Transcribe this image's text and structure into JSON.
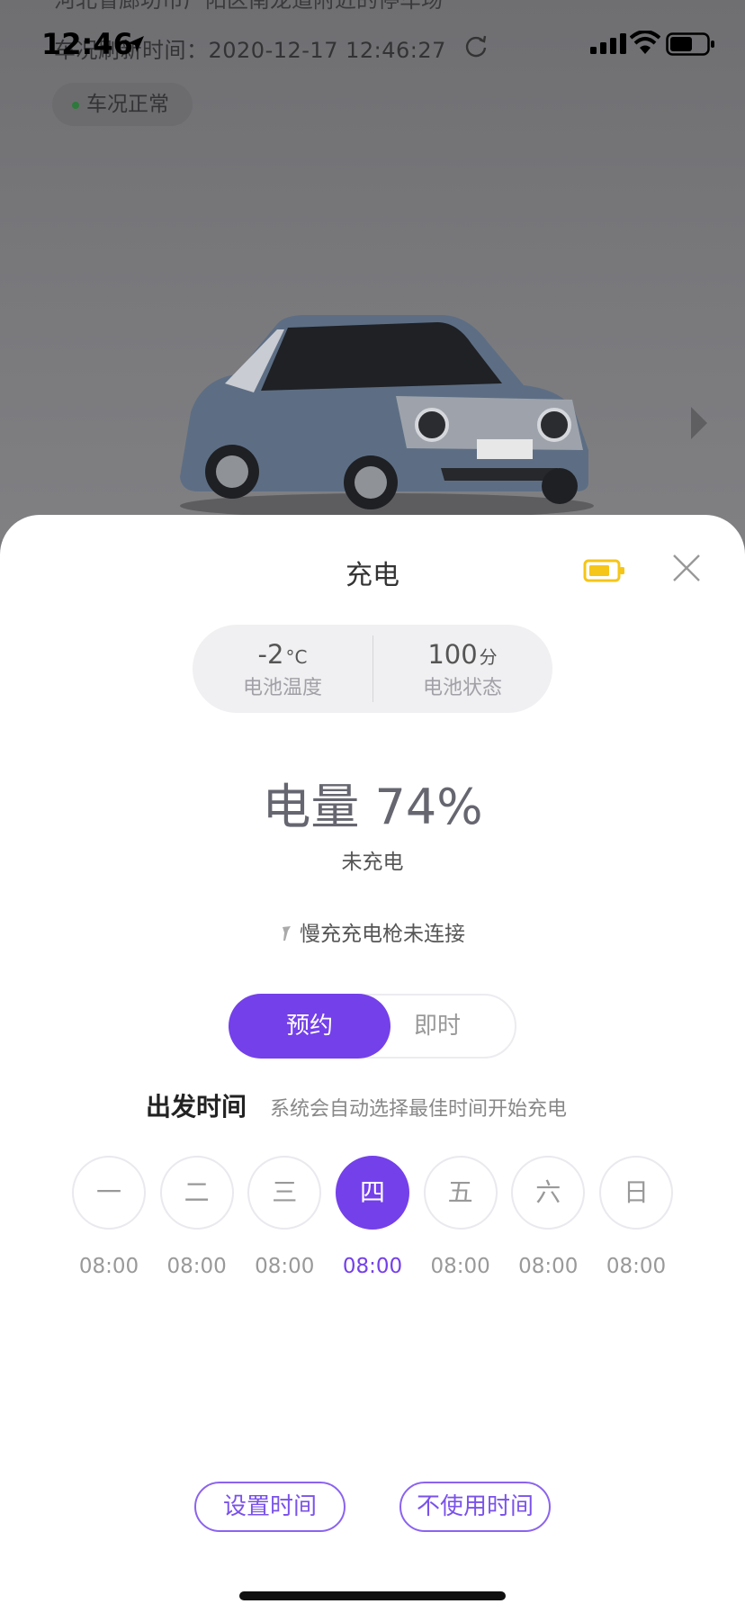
{
  "background": {
    "location_text": "河北省廊坊市广阳区南龙道附近的停车场",
    "refresh_text": "车况刷新时间：2020-12-17 12:46:27",
    "status_pill": "车况正常"
  },
  "statusbar": {
    "time": "12:46"
  },
  "sheet": {
    "title": "充电",
    "battery_temp": {
      "value": "-2",
      "unit": "°C",
      "label": "电池温度"
    },
    "battery_health": {
      "value": "100",
      "unit": "分",
      "label": "电池状态"
    },
    "charge_level": "电量 74%",
    "charge_state": "未充电",
    "gun_status": "慢充充电枪未连接",
    "mode": {
      "scheduled": "预约",
      "instant": "即时"
    },
    "depart_title": "出发时间",
    "depart_hint": "系统会自动选择最佳时间开始充电",
    "days": [
      {
        "label": "一",
        "time": "08:00"
      },
      {
        "label": "二",
        "time": "08:00"
      },
      {
        "label": "三",
        "time": "08:00"
      },
      {
        "label": "四",
        "time": "08:00"
      },
      {
        "label": "五",
        "time": "08:00"
      },
      {
        "label": "六",
        "time": "08:00"
      },
      {
        "label": "日",
        "time": "08:00"
      }
    ],
    "selected_day": "四",
    "set_time_button": "设置时间",
    "no_time_button": "不使用时间"
  },
  "colors": {
    "accent": "#7440ea",
    "battery_yellow": "#f5c518"
  }
}
